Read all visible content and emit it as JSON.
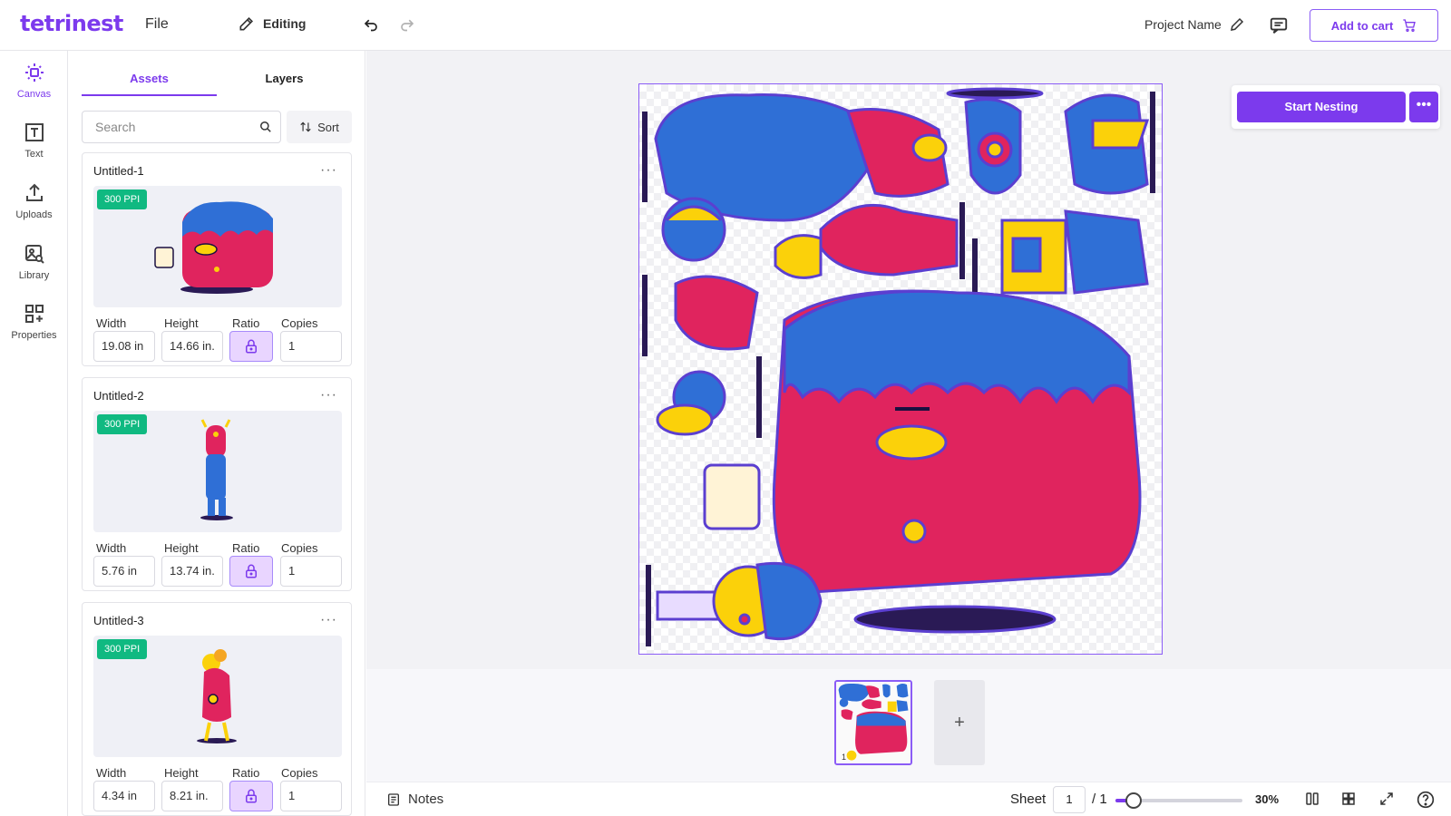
{
  "app": {
    "logo": "tetrinest"
  },
  "topbar": {
    "file_label": "File",
    "mode_label": "Editing",
    "project_name": "Project Name",
    "cart_label": "Add to cart"
  },
  "rail": [
    {
      "label": "Canvas",
      "icon": "canvas-icon",
      "active": true
    },
    {
      "label": "Text",
      "icon": "text-icon"
    },
    {
      "label": "Uploads",
      "icon": "upload-icon"
    },
    {
      "label": "Library",
      "icon": "library-icon"
    },
    {
      "label": "Properties",
      "icon": "properties-icon"
    }
  ],
  "panel": {
    "tabs": [
      "Assets",
      "Layers"
    ],
    "search_placeholder": "Search",
    "sort_label": "Sort",
    "field_labels": {
      "width": "Width",
      "height": "Height",
      "ratio": "Ratio",
      "copies": "Copies"
    },
    "assets": [
      {
        "name": "Untitled-1",
        "ppi": "300 PPI",
        "width": "19.08 in",
        "height": "14.66 in.",
        "copies": "1"
      },
      {
        "name": "Untitled-2",
        "ppi": "300 PPI",
        "width": "5.76 in",
        "height": "13.74 in.",
        "copies": "1"
      },
      {
        "name": "Untitled-3",
        "ppi": "300 PPI",
        "width": "4.34 in",
        "height": "8.21 in.",
        "copies": "1"
      }
    ]
  },
  "canvas": {
    "nest_label": "Start Nesting",
    "more_label": "•••",
    "thumb_number": "1",
    "add_sheet": "+"
  },
  "bottombar": {
    "notes_label": "Notes",
    "sheet_label": "Sheet",
    "sheet_value": "1",
    "sheet_total": "/ 1",
    "zoom_label": "30%",
    "zoom_fraction": 0.14
  },
  "colors": {
    "accent": "#7c3aed",
    "ppi_badge": "#10b981",
    "monster_pink": "#e0245e",
    "monster_blue": "#2f6fd6",
    "monster_yellow": "#fbd10a"
  }
}
